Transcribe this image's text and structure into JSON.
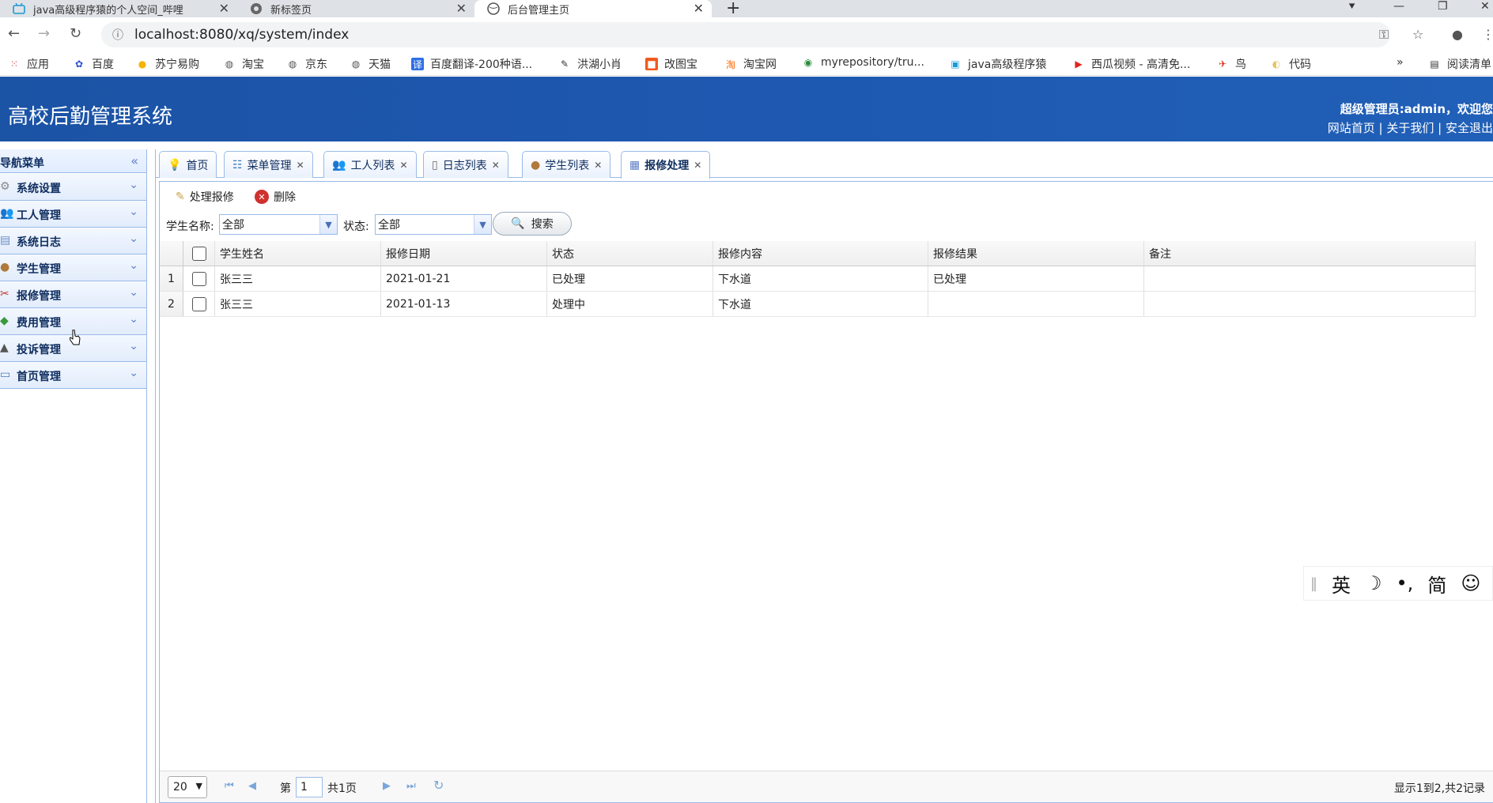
{
  "browser": {
    "tabs": [
      {
        "label": "java高级程序猿的个人空间_哔哩",
        "icon": "bilibili-icon",
        "active": false
      },
      {
        "label": "新标签页",
        "icon": "chrome-icon",
        "active": false
      },
      {
        "label": "后台管理主页",
        "icon": "globe-icon",
        "active": true
      }
    ],
    "url": "localhost:8080/xq/system/index",
    "bookmarks": [
      {
        "label": "应用",
        "icon": "apps-grid-icon"
      },
      {
        "label": "百度",
        "icon": "baidu-paw-icon"
      },
      {
        "label": "苏宁易购",
        "icon": "suning-icon"
      },
      {
        "label": "淘宝",
        "icon": "globe-icon"
      },
      {
        "label": "京东",
        "icon": "globe-icon"
      },
      {
        "label": "天猫",
        "icon": "globe-icon"
      },
      {
        "label": "百度翻译-200种语...",
        "icon": "translate-icon"
      },
      {
        "label": "洪湖小肖",
        "icon": "pen-icon"
      },
      {
        "label": "改图宝",
        "icon": "image-icon"
      },
      {
        "label": "淘宝网",
        "icon": "taobao-icon"
      },
      {
        "label": "myrepository/tru...",
        "icon": "chrome-circle-icon"
      },
      {
        "label": "java高级程序猿",
        "icon": "bilibili-icon"
      },
      {
        "label": "西瓜视频 - 高清免...",
        "icon": "play-icon"
      },
      {
        "label": "鸟",
        "icon": "bird-icon"
      },
      {
        "label": "代码",
        "icon": "code-icon"
      }
    ],
    "more_bookmarks": "»",
    "reading_list": "阅读清单"
  },
  "app": {
    "title": "高校后勤管理系统",
    "welcome": "超级管理员:admin，欢迎您",
    "links": [
      "网站首页",
      "关于我们",
      "安全退出"
    ],
    "header_color": "#1e58b0"
  },
  "sidebar": {
    "title": "导航菜单",
    "items": [
      {
        "label": "系统设置",
        "icon": "gear-icon"
      },
      {
        "label": "工人管理",
        "icon": "users-icon"
      },
      {
        "label": "系统日志",
        "icon": "log-icon"
      },
      {
        "label": "学生管理",
        "icon": "student-icon"
      },
      {
        "label": "报修管理",
        "icon": "tools-icon"
      },
      {
        "label": "费用管理",
        "icon": "money-icon"
      },
      {
        "label": "投诉管理",
        "icon": "complaint-icon"
      },
      {
        "label": "首页管理",
        "icon": "homepage-icon"
      }
    ]
  },
  "page_tabs": [
    {
      "label": "首页",
      "icon": "bulb-icon",
      "closable": false
    },
    {
      "label": "菜单管理",
      "icon": "sitemap-icon",
      "closable": true
    },
    {
      "label": "工人列表",
      "icon": "users-icon",
      "closable": true
    },
    {
      "label": "日志列表",
      "icon": "document-icon",
      "closable": true
    },
    {
      "label": "学生列表",
      "icon": "student-icon",
      "closable": true
    },
    {
      "label": "报修处理",
      "icon": "table-icon",
      "closable": true,
      "active": true
    }
  ],
  "toolbar": {
    "process_label": "处理报修",
    "delete_label": "删除"
  },
  "search": {
    "student_label": "学生名称:",
    "student_value": "全部",
    "status_label": "状态:",
    "status_value": "全部",
    "button_label": "搜索"
  },
  "grid": {
    "columns": [
      "学生姓名",
      "报修日期",
      "状态",
      "报修内容",
      "报修结果",
      "备注"
    ],
    "rows": [
      {
        "num": "1",
        "name": "张三三",
        "date": "2021-01-21",
        "status": "已处理",
        "content": "下水道",
        "result": "已处理",
        "note": ""
      },
      {
        "num": "2",
        "name": "张三三",
        "date": "2021-01-13",
        "status": "处理中",
        "content": "下水道",
        "result": "",
        "note": ""
      }
    ]
  },
  "pager": {
    "page_size": "20",
    "page_prefix": "第",
    "page_value": "1",
    "page_suffix": "共1页",
    "summary": "显示1到2,共2记录"
  },
  "ime": [
    "英",
    "☽",
    "•,",
    "简",
    "☺",
    "⚙"
  ]
}
